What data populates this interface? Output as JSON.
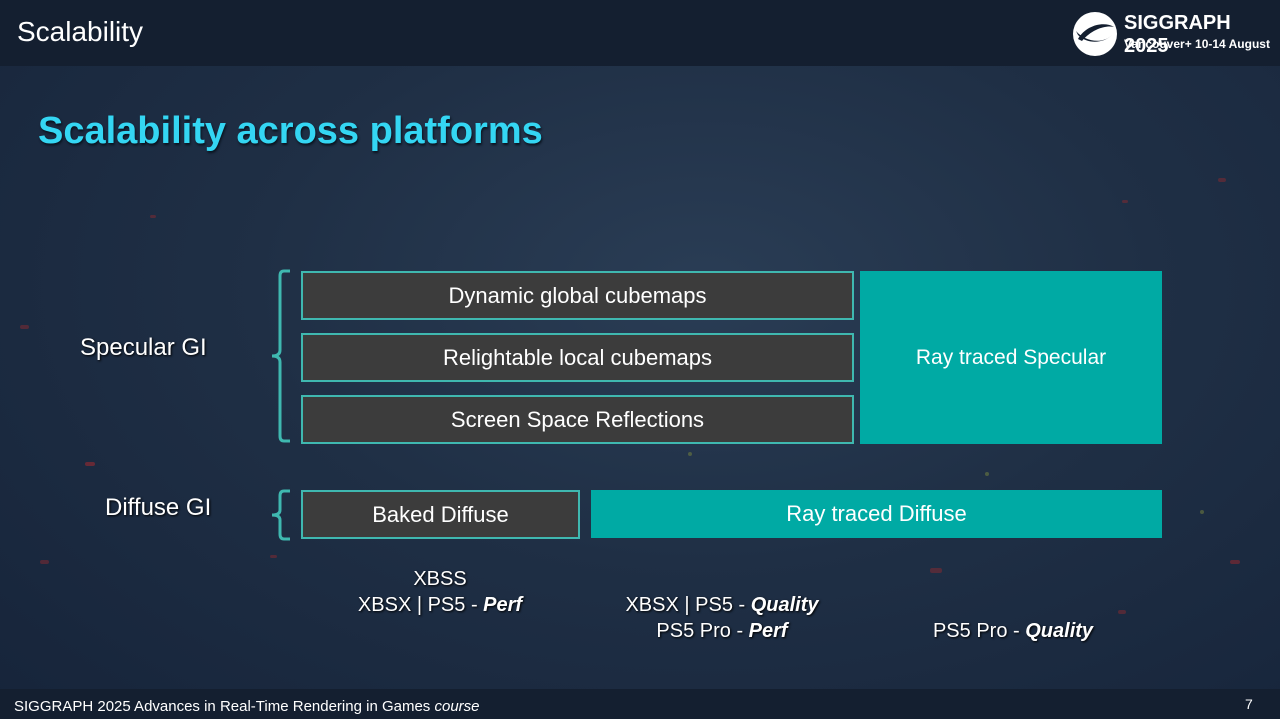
{
  "header": {
    "section_title": "Scalability",
    "logo_title": "SIGGRAPH 2025",
    "logo_subtitle": "Vancouver+ 10-14 August",
    "logo_icon": "siggraph-logo-icon"
  },
  "slide": {
    "title": "Scalability across platforms",
    "specular_label": "Specular GI",
    "diffuse_label": "Diffuse GI",
    "boxes": {
      "dynamic_cubemaps": "Dynamic global cubemaps",
      "relightable_cubemaps": "Relightable local cubemaps",
      "ssr": "Screen Space Reflections",
      "rt_specular": "Ray traced Specular",
      "baked_diffuse": "Baked Diffuse",
      "rt_diffuse": "Ray traced Diffuse"
    },
    "platforms": {
      "col1_line1": "XBSS",
      "col1_line2_prefix": "XBSX | PS5 - ",
      "col1_line2_mode": "Perf",
      "col2_line1_prefix": "XBSX | PS5 - ",
      "col2_line1_mode": "Quality",
      "col2_line2_prefix": "PS5 Pro - ",
      "col2_line2_mode": "Perf",
      "col3_prefix": "PS5 Pro - ",
      "col3_mode": "Quality"
    }
  },
  "footer": {
    "text": "SIGGRAPH 2025 Advances in Real-Time Rendering in Games",
    "text_italic": "course",
    "page_number": "7"
  },
  "colors": {
    "accent_title": "#34d6f3",
    "teal": "#00aaa4",
    "grey_box": "#3c3c3c",
    "bracket": "#3fb8b0"
  }
}
